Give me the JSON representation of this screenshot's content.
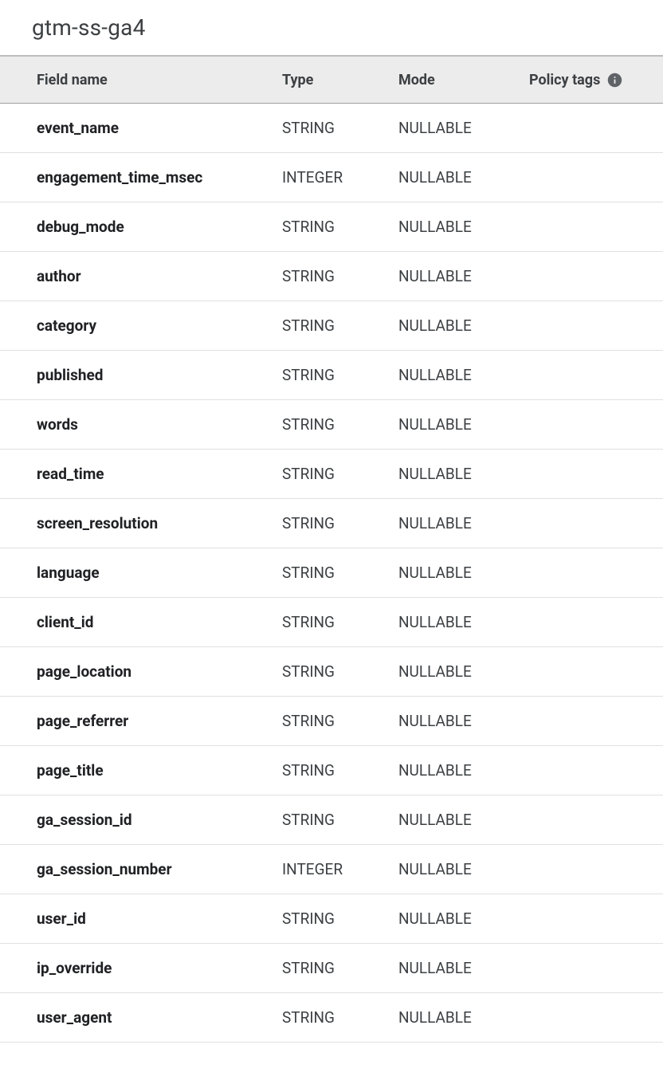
{
  "title": "gtm-ss-ga4",
  "columns": {
    "field_name": "Field name",
    "type": "Type",
    "mode": "Mode",
    "policy_tags": "Policy tags"
  },
  "rows": [
    {
      "name": "event_name",
      "type": "STRING",
      "mode": "NULLABLE",
      "policy": ""
    },
    {
      "name": "engagement_time_msec",
      "type": "INTEGER",
      "mode": "NULLABLE",
      "policy": ""
    },
    {
      "name": "debug_mode",
      "type": "STRING",
      "mode": "NULLABLE",
      "policy": ""
    },
    {
      "name": "author",
      "type": "STRING",
      "mode": "NULLABLE",
      "policy": ""
    },
    {
      "name": "category",
      "type": "STRING",
      "mode": "NULLABLE",
      "policy": ""
    },
    {
      "name": "published",
      "type": "STRING",
      "mode": "NULLABLE",
      "policy": ""
    },
    {
      "name": "words",
      "type": "STRING",
      "mode": "NULLABLE",
      "policy": ""
    },
    {
      "name": "read_time",
      "type": "STRING",
      "mode": "NULLABLE",
      "policy": ""
    },
    {
      "name": "screen_resolution",
      "type": "STRING",
      "mode": "NULLABLE",
      "policy": ""
    },
    {
      "name": "language",
      "type": "STRING",
      "mode": "NULLABLE",
      "policy": ""
    },
    {
      "name": "client_id",
      "type": "STRING",
      "mode": "NULLABLE",
      "policy": ""
    },
    {
      "name": "page_location",
      "type": "STRING",
      "mode": "NULLABLE",
      "policy": ""
    },
    {
      "name": "page_referrer",
      "type": "STRING",
      "mode": "NULLABLE",
      "policy": ""
    },
    {
      "name": "page_title",
      "type": "STRING",
      "mode": "NULLABLE",
      "policy": ""
    },
    {
      "name": "ga_session_id",
      "type": "STRING",
      "mode": "NULLABLE",
      "policy": ""
    },
    {
      "name": "ga_session_number",
      "type": "INTEGER",
      "mode": "NULLABLE",
      "policy": ""
    },
    {
      "name": "user_id",
      "type": "STRING",
      "mode": "NULLABLE",
      "policy": ""
    },
    {
      "name": "ip_override",
      "type": "STRING",
      "mode": "NULLABLE",
      "policy": ""
    },
    {
      "name": "user_agent",
      "type": "STRING",
      "mode": "NULLABLE",
      "policy": ""
    }
  ]
}
